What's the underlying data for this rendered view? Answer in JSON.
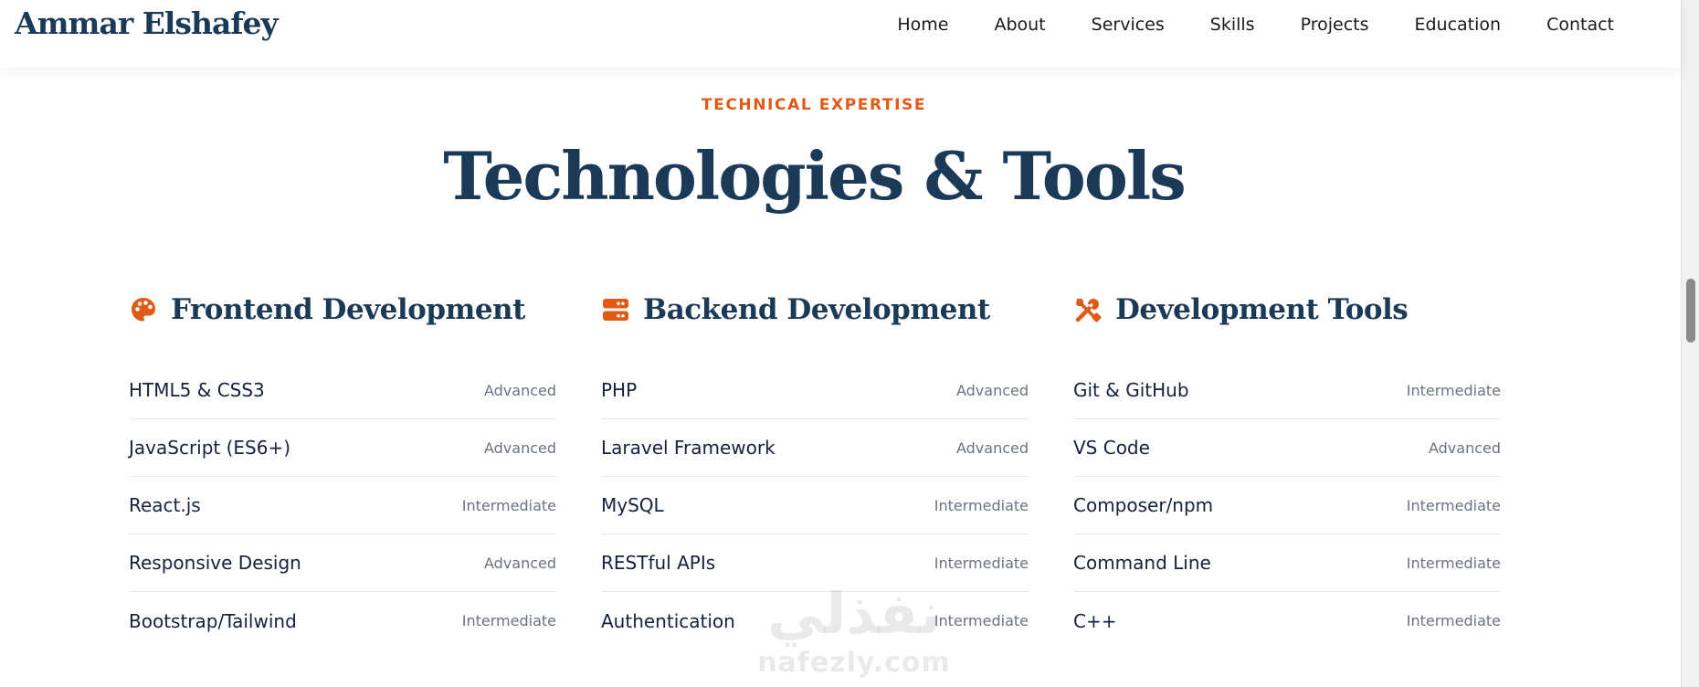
{
  "header": {
    "logo": "Ammar Elshafey",
    "nav": [
      "Home",
      "About",
      "Services",
      "Skills",
      "Projects",
      "Education",
      "Contact"
    ]
  },
  "section": {
    "eyebrow": "TECHNICAL EXPERTISE",
    "title": "Technologies & Tools"
  },
  "columns": [
    {
      "title": "Frontend Development",
      "icon": "palette-icon",
      "items": [
        {
          "name": "HTML5 & CSS3",
          "level": "Advanced"
        },
        {
          "name": "JavaScript (ES6+)",
          "level": "Advanced"
        },
        {
          "name": "React.js",
          "level": "Intermediate"
        },
        {
          "name": "Responsive Design",
          "level": "Advanced"
        },
        {
          "name": "Bootstrap/Tailwind",
          "level": "Intermediate"
        }
      ]
    },
    {
      "title": "Backend Development",
      "icon": "server-icon",
      "items": [
        {
          "name": "PHP",
          "level": "Advanced"
        },
        {
          "name": "Laravel Framework",
          "level": "Advanced"
        },
        {
          "name": "MySQL",
          "level": "Intermediate"
        },
        {
          "name": "RESTful APIs",
          "level": "Intermediate"
        },
        {
          "name": "Authentication",
          "level": "Intermediate"
        }
      ]
    },
    {
      "title": "Development Tools",
      "icon": "tools-icon",
      "items": [
        {
          "name": "Git & GitHub",
          "level": "Intermediate"
        },
        {
          "name": "VS Code",
          "level": "Advanced"
        },
        {
          "name": "Composer/npm",
          "level": "Intermediate"
        },
        {
          "name": "Command Line",
          "level": "Intermediate"
        },
        {
          "name": "C++",
          "level": "Intermediate"
        }
      ]
    }
  ],
  "watermark": {
    "logo": "نفذلي",
    "url": "nafezly.com"
  },
  "colors": {
    "accent": "#e05a16",
    "navy": "#1b3a57",
    "muted": "#6b7280",
    "divider": "#e6e8ec"
  }
}
